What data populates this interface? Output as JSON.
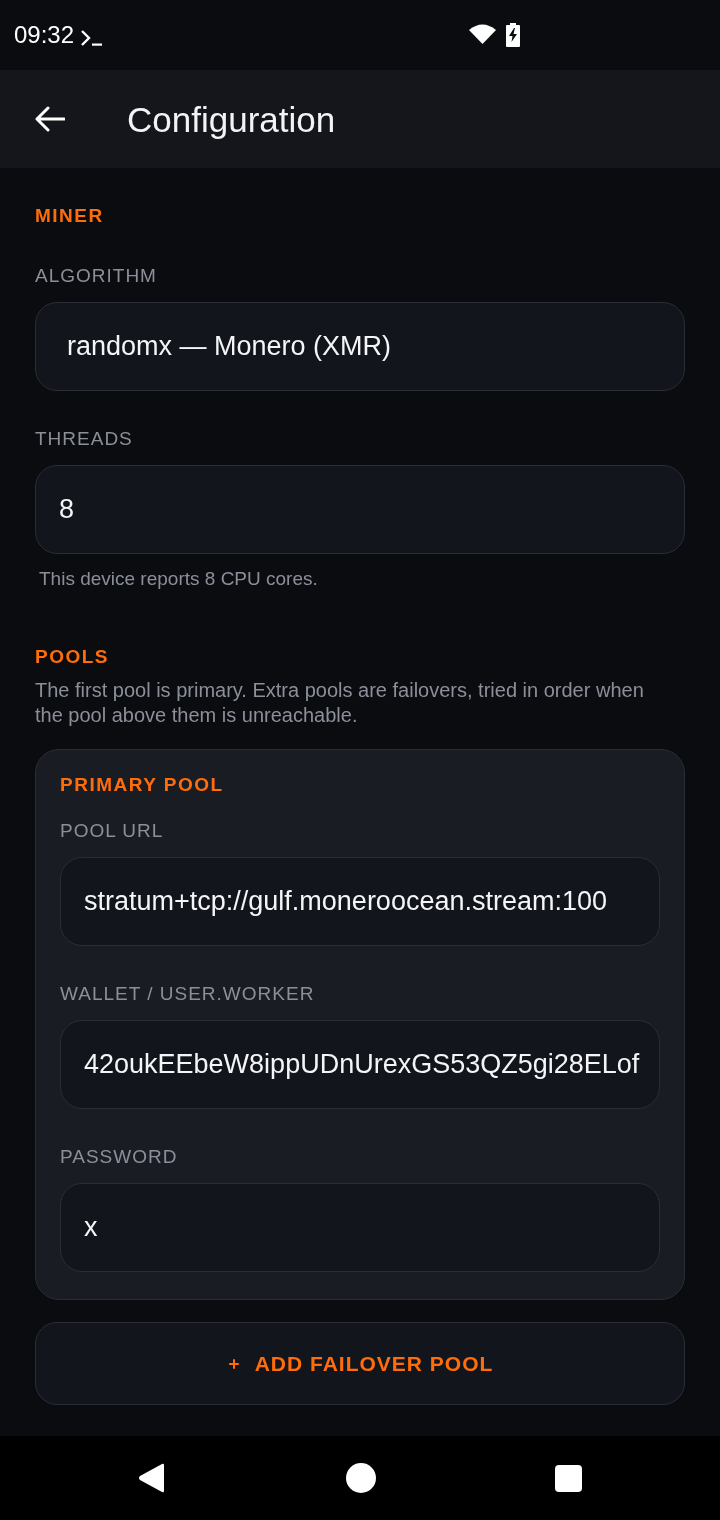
{
  "status_bar": {
    "time": "09:32"
  },
  "app_bar": {
    "title": "Configuration"
  },
  "miner": {
    "heading": "MINER",
    "fields": [
      {
        "kind": "select",
        "label": "ALGORITHM",
        "value": "randomx — Monero (XMR)"
      },
      {
        "kind": "text",
        "label": "THREADS",
        "value": "8",
        "helper": "This device reports 8 CPU cores."
      }
    ]
  },
  "pools": {
    "heading": "POOLS",
    "description": "The first pool is primary. Extra pools are failovers, tried in order when the pool above them is unreachable.",
    "cards": [
      {
        "title": "PRIMARY POOL",
        "fields": [
          {
            "kind": "text",
            "label": "POOL URL",
            "value": "stratum+tcp://gulf.moneroocean.stream:100"
          },
          {
            "kind": "text",
            "label": "WALLET / USER.WORKER",
            "value": "42oukEEbeW8ippUDnUrexGS53QZ5gi28ELof"
          },
          {
            "kind": "text",
            "label": "PASSWORD",
            "value": "x"
          }
        ]
      }
    ],
    "add_button": "ADD FAILOVER POOL"
  }
}
